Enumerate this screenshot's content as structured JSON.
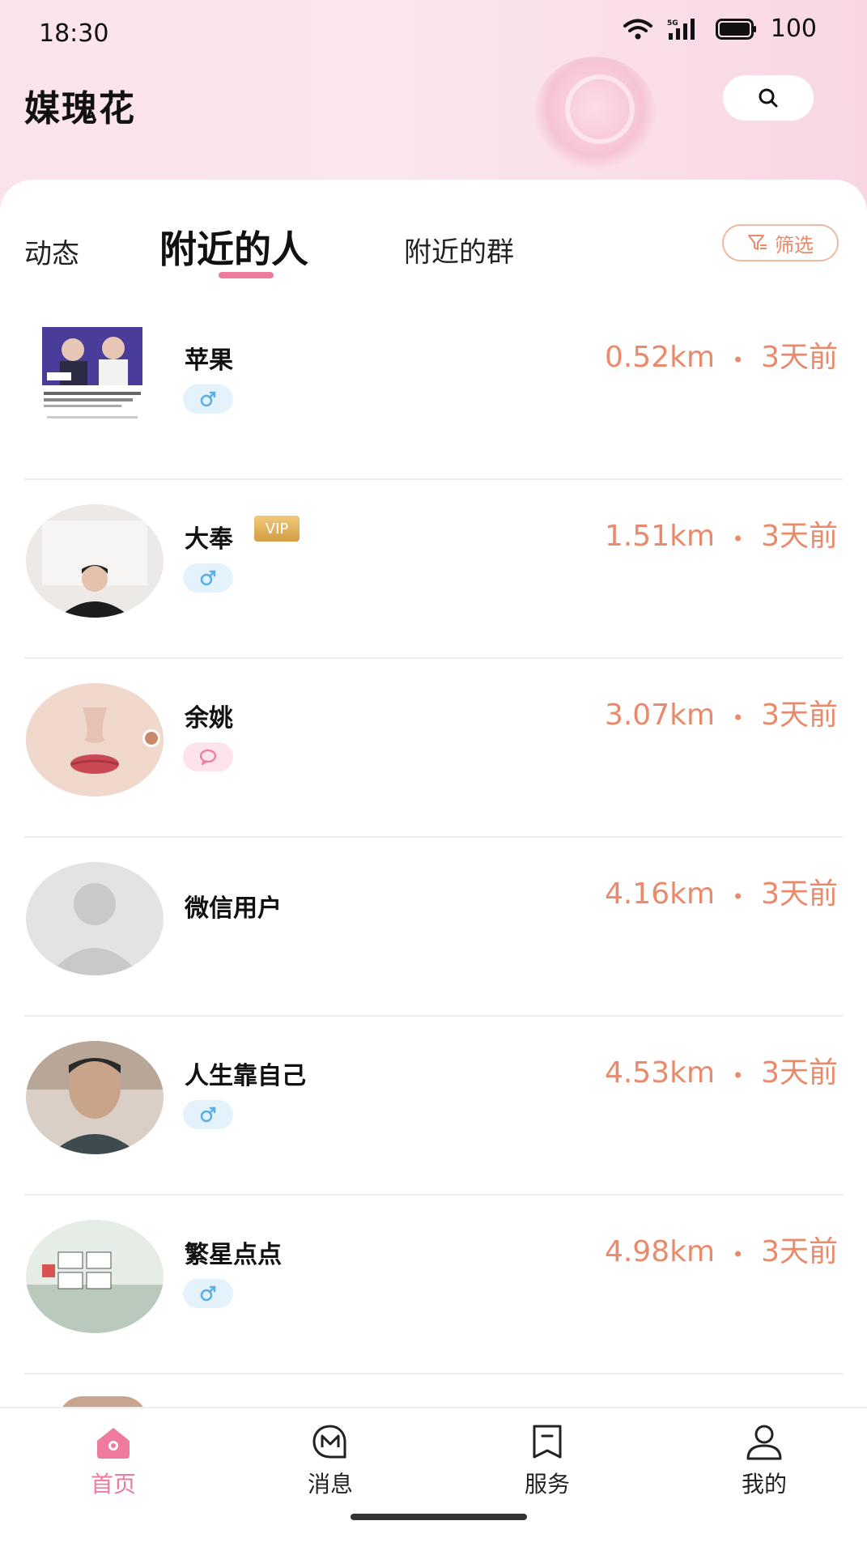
{
  "status_bar": {
    "time": "18:30",
    "network": "5G",
    "battery": "100"
  },
  "app": {
    "title": "媒瑰花"
  },
  "tabs": [
    {
      "label": "动态",
      "active": false
    },
    {
      "label": "附近的人",
      "active": true
    },
    {
      "label": "附近的群",
      "active": false
    }
  ],
  "filter": {
    "label": "筛选"
  },
  "users": [
    {
      "name": "苹果",
      "distance": "0.52km",
      "time": "3天前",
      "vip": false,
      "badge": "male-icon"
    },
    {
      "name": "大奉",
      "distance": "1.51km",
      "time": "3天前",
      "vip": true,
      "vip_label": "VIP",
      "badge": "male-icon"
    },
    {
      "name": "余姚",
      "distance": "3.07km",
      "time": "3天前",
      "vip": false,
      "badge": "chat-bubble-icon"
    },
    {
      "name": "微信用户",
      "distance": "4.16km",
      "time": "3天前",
      "vip": false,
      "badge": null
    },
    {
      "name": "人生靠自己",
      "distance": "4.53km",
      "time": "3天前",
      "vip": false,
      "badge": "male-icon"
    },
    {
      "name": "繁星点点",
      "distance": "4.98km",
      "time": "3天前",
      "vip": false,
      "badge": "male-icon"
    }
  ],
  "separator": "•",
  "bottom_nav": [
    {
      "label": "首页",
      "icon": "home-icon",
      "active": true
    },
    {
      "label": "消息",
      "icon": "message-icon",
      "active": false
    },
    {
      "label": "服务",
      "icon": "service-icon",
      "active": false
    },
    {
      "label": "我的",
      "icon": "profile-icon",
      "active": false
    }
  ],
  "colors": {
    "accent": "#ee7b9e",
    "distance": "#e98a6b",
    "male_badge": "#e4f2fb",
    "header_bg": "#fbe3ea"
  }
}
